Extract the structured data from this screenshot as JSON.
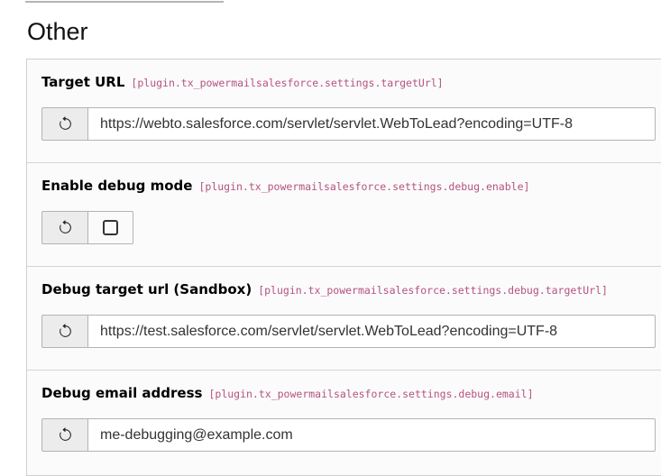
{
  "page": {
    "heading": "Other"
  },
  "colors": {
    "constant_path_pink": "#b5537f",
    "panel_border": "#cfcfcf",
    "panel_background": "#fbfbfb",
    "reset_button_background": "#ececec",
    "input_border": "#b3b3b3",
    "input_text": "#333333"
  },
  "icons": {
    "reset": "undo-reset-icon",
    "checkbox": "checkbox-unchecked-icon"
  },
  "settings": [
    {
      "label": "Target URL",
      "constant": "[plugin.tx_powermailsalesforce.settings.targetUrl]",
      "type": "text",
      "value": "https://webto.salesforce.com/servlet/servlet.WebToLead?encoding=UTF-8"
    },
    {
      "label": "Enable debug mode",
      "constant": "[plugin.tx_powermailsalesforce.settings.debug.enable]",
      "type": "checkbox",
      "checked": false
    },
    {
      "label": "Debug target url (Sandbox)",
      "constant": "[plugin.tx_powermailsalesforce.settings.debug.targetUrl]",
      "type": "text",
      "value": "https://test.salesforce.com/servlet/servlet.WebToLead?encoding=UTF-8"
    },
    {
      "label": "Debug email address",
      "constant": "[plugin.tx_powermailsalesforce.settings.debug.email]",
      "type": "text",
      "value": "me-debugging@example.com"
    }
  ]
}
